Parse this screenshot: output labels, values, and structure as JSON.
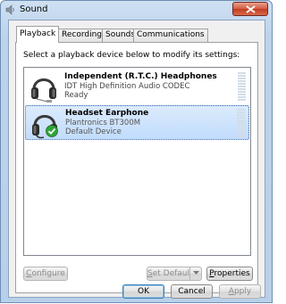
{
  "window": {
    "title": "Sound",
    "icon": "speaker-icon",
    "close_icon": "close-x-icon",
    "close_color": "#c7432a"
  },
  "tabs": [
    {
      "label": "Playback",
      "active": true
    },
    {
      "label": "Recording",
      "active": false
    },
    {
      "label": "Sounds",
      "active": false
    },
    {
      "label": "Communications",
      "active": false
    }
  ],
  "playback": {
    "instruction": "Select a playback device below to modify its settings:",
    "devices": [
      {
        "name": "Independent (R.T.C.) Headphones",
        "driver": "IDT High Definition Audio CODEC",
        "status": "Ready",
        "icon": "headphones-icon",
        "selected": false
      },
      {
        "name": "Headset Earphone",
        "driver": "Plantronics BT300M",
        "status": "Default Device",
        "icon": "headset-icon",
        "badge_icon": "default-check-icon",
        "selected": true
      }
    ],
    "selection_color": "#c1dcfc"
  },
  "buttons": {
    "configure": {
      "accesskey": "C",
      "rest": "onfigure"
    },
    "set_default": {
      "accesskey": "S",
      "rest": "et Default"
    },
    "properties": {
      "accesskey": "P",
      "rest": "roperties"
    },
    "ok": "OK",
    "cancel": "Cancel",
    "apply": {
      "accesskey": "A",
      "rest": "pply"
    }
  }
}
